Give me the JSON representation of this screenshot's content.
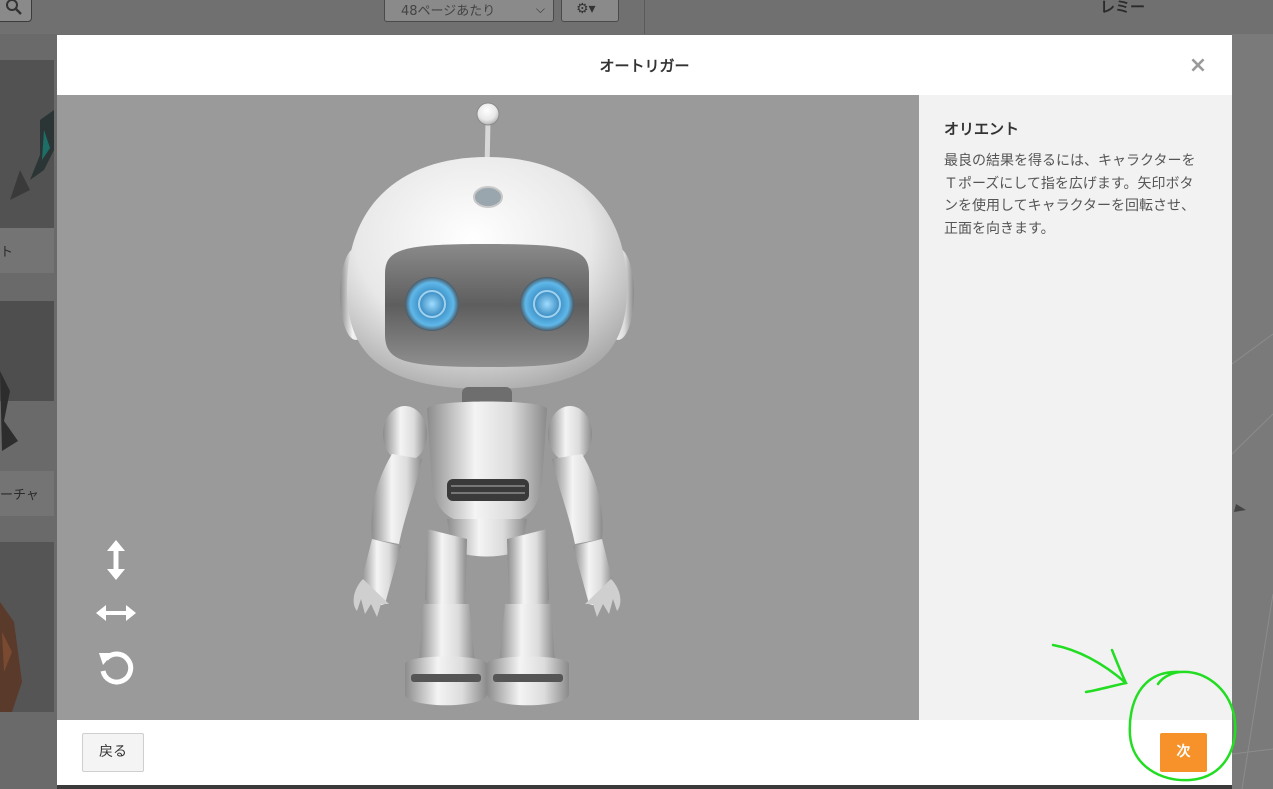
{
  "background": {
    "perpage_select": {
      "value": "48ページあたり"
    },
    "preview_title": "レミー",
    "cards": [
      {
        "label": "ト"
      },
      {
        "label": "ーチャ"
      }
    ]
  },
  "modal": {
    "title": "オートリガー",
    "close_label": "×",
    "side_panel": {
      "title": "オリエント",
      "description": "最良の結果を得るには、キャラクターをＴポーズにして指を広げます。矢印ボタンを使用してキャラクターを回転させ、正面を向きます。"
    },
    "controls": [
      {
        "name": "vertical-arrows-icon"
      },
      {
        "name": "horizontal-arrows-icon"
      },
      {
        "name": "rotate-icon"
      }
    ],
    "footer": {
      "back_label": "戻る",
      "next_label": "次"
    }
  },
  "colors": {
    "accent": "#f7922a",
    "viewport_bg": "#9a9a9a",
    "side_panel_bg": "#f2f2f2",
    "annotation": "#22dd22"
  }
}
